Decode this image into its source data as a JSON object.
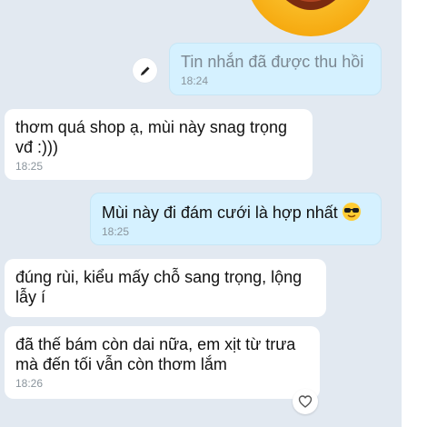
{
  "messages": [
    {
      "text": "Tin nhắn đã được thu hồi",
      "time": "18:24"
    },
    {
      "text": "thơm quá shop ạ, mùi này snag trọng\nvđ :)))",
      "time": "18:25"
    },
    {
      "text": "Mùi này đi đám cưới là hợp nhất",
      "time": "18:25",
      "emoji": "sunglasses-face"
    },
    {
      "text": "đúng rùi, kiểu mấy chỗ sang trọng, lộng\nlẫy í"
    },
    {
      "text": "đã thế bám còn dai nữa, em xịt từ trưa\nmà đến tối vẫn còn thơm lắm",
      "time": "18:26"
    }
  ],
  "icons": {
    "sticker": "laughing-face-sticker",
    "edit": "pencil-icon",
    "react": "heart-icon"
  },
  "colors": {
    "chat_background": "#e2e9f1",
    "outgoing_bubble": "#d5f1ff",
    "incoming_bubble": "#ffffff"
  }
}
